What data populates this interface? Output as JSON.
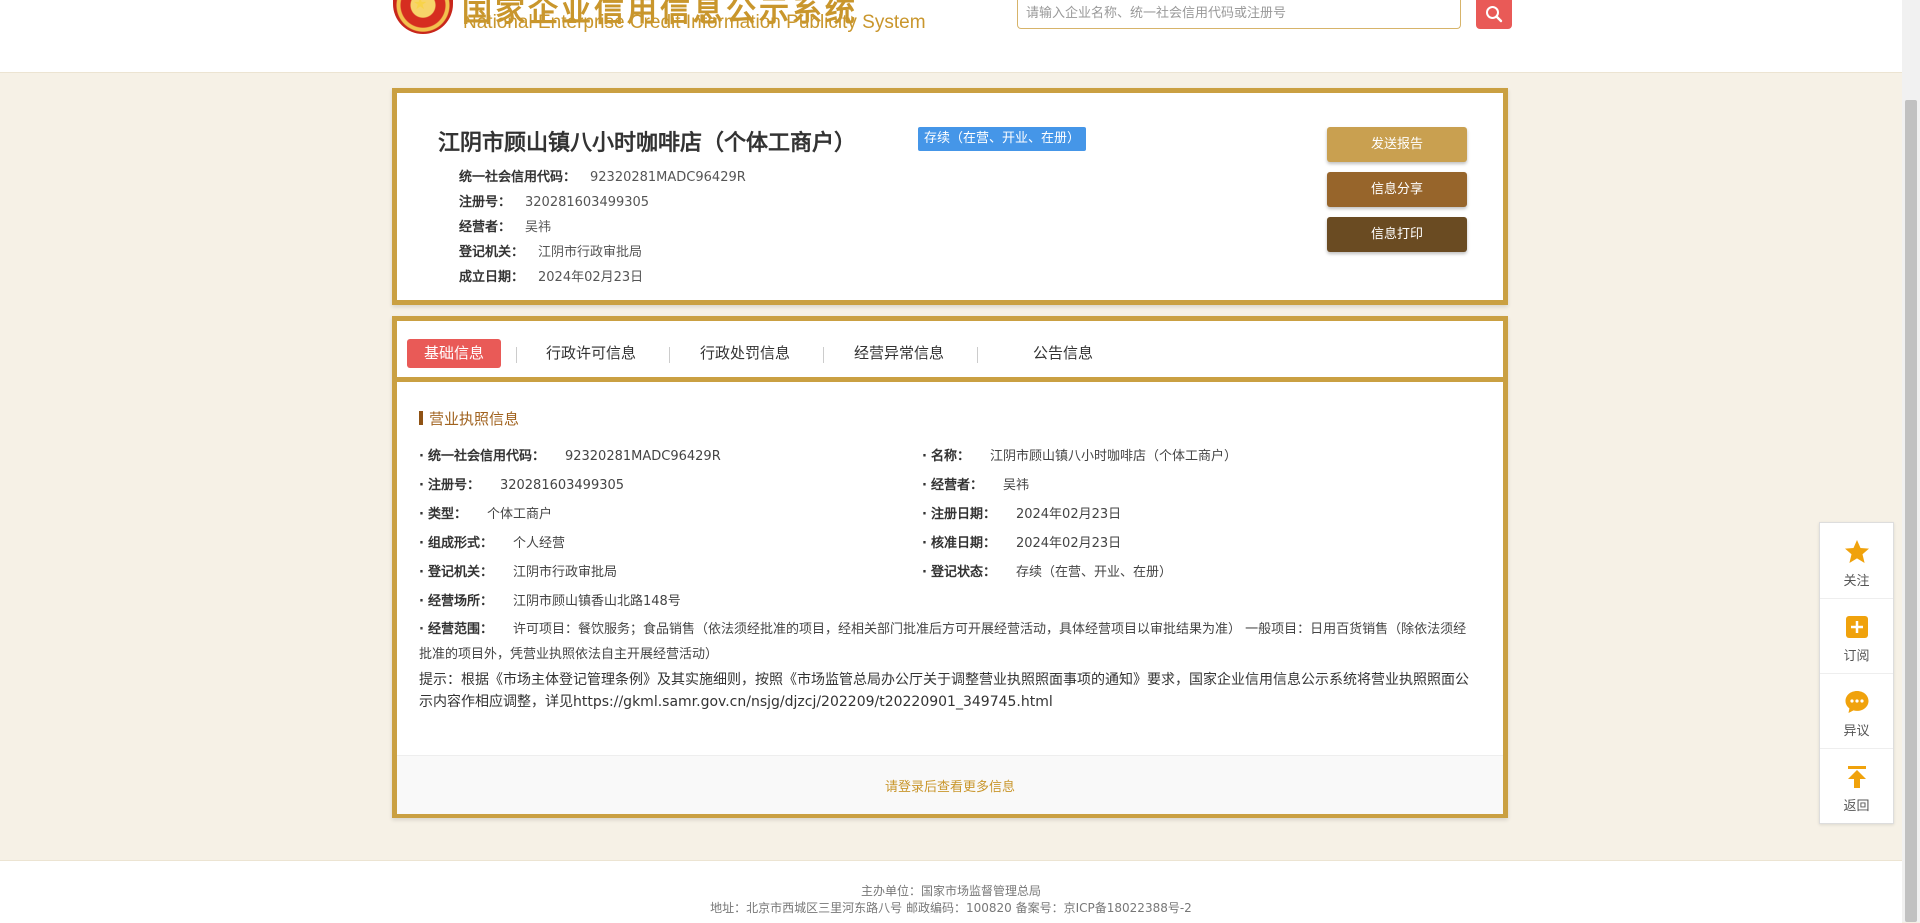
{
  "header": {
    "title_cn": "国家企业信用信息公示系统",
    "title_en": "National Enterprise Credit Information Publicity System",
    "search_placeholder": "请输入企业名称、统一社会信用代码或注册号"
  },
  "company": {
    "name": "江阴市顾山镇八小时咖啡店（个体工商户）",
    "status": "存续（在营、开业、在册）",
    "summary": [
      {
        "label": "统一社会信用代码：",
        "value": "92320281MADC96429R"
      },
      {
        "label": "注册号：",
        "value": "320281603499305"
      },
      {
        "label": "经营者：",
        "value": "吴祎"
      },
      {
        "label": "登记机关：",
        "value": "江阴市行政审批局"
      },
      {
        "label": "成立日期：",
        "value": "2024年02月23日"
      }
    ]
  },
  "actions": {
    "send_report": "发送报告",
    "share": "信息分享",
    "print": "信息打印"
  },
  "tabs": [
    "基础信息",
    "行政许可信息",
    "行政处罚信息",
    "经营异常信息",
    "公告信息"
  ],
  "license": {
    "section_title": "营业执照信息",
    "left": [
      {
        "label": "统一社会信用代码：",
        "value": "92320281MADC96429R"
      },
      {
        "label": "注册号：",
        "value": "320281603499305"
      },
      {
        "label": "类型：",
        "value": "个体工商户"
      },
      {
        "label": "组成形式：",
        "value": "个人经营"
      },
      {
        "label": "登记机关：",
        "value": "江阴市行政审批局"
      },
      {
        "label": "经营场所：",
        "value": "江阴市顾山镇香山北路148号"
      }
    ],
    "right": [
      {
        "label": "名称：",
        "value": "江阴市顾山镇八小时咖啡店（个体工商户）"
      },
      {
        "label": "经营者：",
        "value": "吴祎"
      },
      {
        "label": "注册日期：",
        "value": "2024年02月23日"
      },
      {
        "label": "核准日期：",
        "value": "2024年02月23日"
      },
      {
        "label": "登记状态：",
        "value": "存续（在营、开业、在册）"
      }
    ],
    "scope_label": "经营范围：",
    "scope_value": "许可项目：餐饮服务；食品销售（依法须经批准的项目，经相关部门批准后方可开展经营活动，具体经营项目以审批结果为准） 一般项目：日用百货销售（除依法须经批准的项目外，凭营业执照依法自主开展经营活动）",
    "tip": "提示：根据《市场主体登记管理条例》及其实施细则，按照《市场监管总局办公厅关于调整营业执照照面事项的通知》要求，国家企业信用信息公示系统将营业执照照面公示内容作相应调整，详见https://gkml.samr.gov.cn/nsjg/djzcj/202209/t20220901_349745.html",
    "more_link": "请登录后查看更多信息"
  },
  "footer": {
    "line1": "主办单位：国家市场监督管理总局",
    "line2": "地址：北京市西城区三里河东路八号   邮政编码：100820   备案号：京ICP备18022388号-2"
  },
  "side": [
    {
      "label": "关注",
      "icon": "star-icon"
    },
    {
      "label": "订阅",
      "icon": "subscribe-icon"
    },
    {
      "label": "异议",
      "icon": "comment-icon"
    },
    {
      "label": "返回",
      "icon": "back-to-top-icon"
    }
  ],
  "colors": {
    "gold": "#caa042",
    "active_tab": "#e95a57",
    "status_badge": "#4596e8"
  }
}
